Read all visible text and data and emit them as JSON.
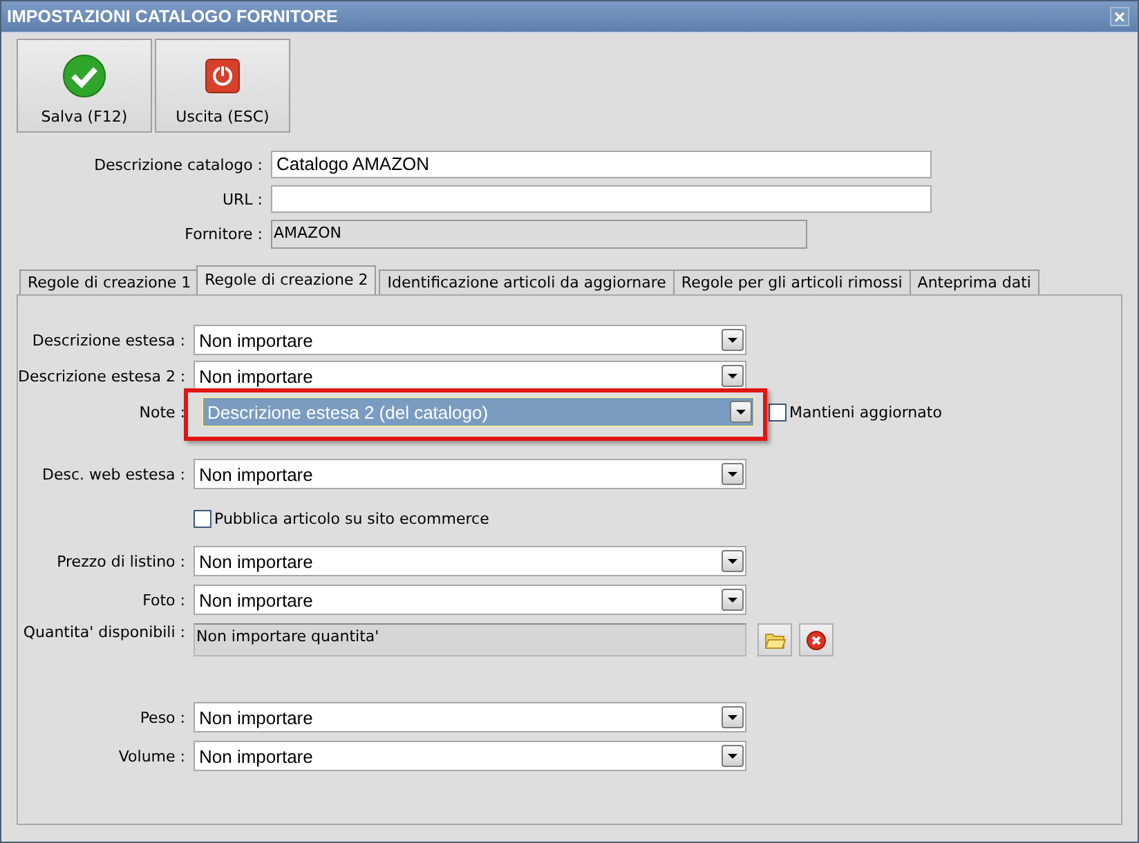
{
  "window": {
    "title": "IMPOSTAZIONI CATALOGO FORNITORE",
    "close": "×"
  },
  "toolbar": [
    {
      "kind": "save",
      "label": "Salva (F12)"
    },
    {
      "kind": "exit",
      "label": "Uscita (ESC)"
    }
  ],
  "header_fields": [
    {
      "label": "Descrizione catalogo :",
      "value": "Catalogo AMAZON",
      "readonly": false
    },
    {
      "label": "URL :",
      "readonly": false
    },
    {
      "label": "Fornitore :",
      "value": "AMAZON",
      "readonly": true
    }
  ],
  "tabs": [
    {
      "label": "Regole di creazione 1",
      "selected": false
    },
    {
      "label": "Regole di creazione 2",
      "selected": true
    },
    {
      "label": "Identificazione articoli da aggiornare",
      "selected": false
    },
    {
      "label": "Regole per gli articoli rimossi",
      "selected": false
    },
    {
      "label": "Anteprima dati",
      "selected": false
    }
  ],
  "rows": [
    {
      "kind": "combo",
      "label": "Descrizione estesa :",
      "value": "Non importare",
      "highlighted": false
    },
    {
      "kind": "combo",
      "label": "Descrizione estesa 2 :",
      "value": "Non importare",
      "highlighted": false
    },
    {
      "kind": "combo",
      "label": "Note :",
      "value": "Descrizione estesa 2 (del catalogo)",
      "highlighted": true,
      "focused": true,
      "option": {
        "label": "Mantieni aggiornato",
        "checked": false
      }
    },
    {
      "kind": "combo",
      "label": "Desc. web estesa :",
      "value": "Non importare",
      "highlighted": false
    },
    {
      "kind": "checkbox",
      "label": "Pubblica articolo su sito ecommerce",
      "checked": false
    },
    {
      "kind": "combo",
      "label": "Prezzo di listino :",
      "value": "Non importare",
      "highlighted": false
    },
    {
      "kind": "combo",
      "label": "Foto :",
      "value": "Non importare",
      "highlighted": false
    },
    {
      "kind": "readonly",
      "label": "Quantita' disponibili :",
      "value": "Non importare quantita'"
    },
    {
      "kind": "combo",
      "label": "Peso :",
      "value": "Non importare",
      "highlighted": false
    },
    {
      "kind": "combo",
      "label": "Volume :",
      "value": "Non importare",
      "highlighted": false
    }
  ]
}
